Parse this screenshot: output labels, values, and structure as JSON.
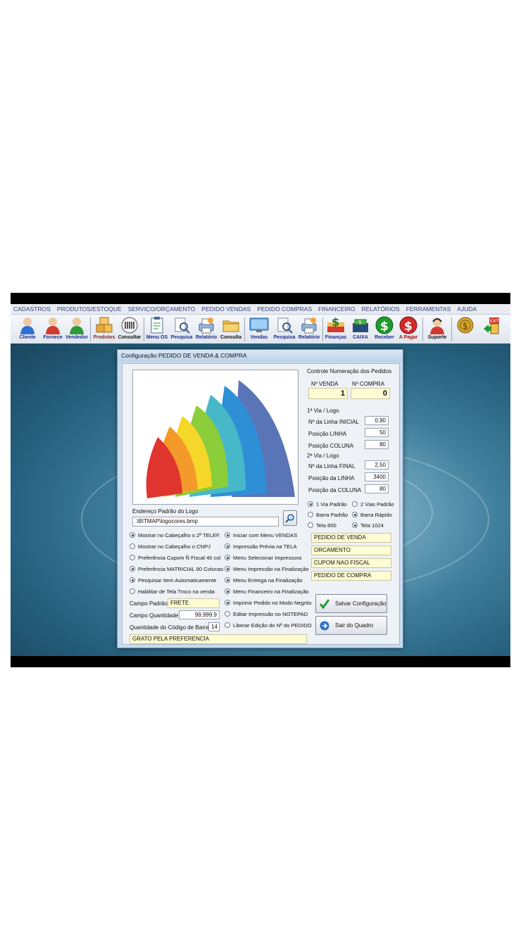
{
  "menu": [
    "CADASTROS",
    "PRODUTOS/ESTOQUE",
    "SERVIÇO/ORÇAMENTO",
    "PEDIDO VENDAS",
    "PEDIDO COMPRAS",
    "FINANCEIRO",
    "RELATÓRIOS",
    "FERRAMENTAS",
    "AJUDA"
  ],
  "toolbar": {
    "cliente": "Cliente",
    "fornece": "Fornece",
    "vendedor": "Vendedor",
    "produtos": "Produtos",
    "consultar": "Consultar",
    "menu_os": "Menu OS",
    "pesquisa": "Pesquisa",
    "relatorio": "Relatório",
    "consulta": "Consulta",
    "vendas": "Vendas",
    "pesquisa2": "Pesquisa",
    "relatorio2": "Relatório",
    "financas": "Finanças",
    "caixa": "CAIXA",
    "receber": "Receber",
    "a_pagar": "A Pagar",
    "suporte": "Suporte"
  },
  "dialog": {
    "title": "Configuração PEDIDO DE VENDA & COMPRA",
    "logo_address_label": "Endereço Padrão do Logo",
    "logo_path": ".\\BITMAP\\logocores.bmp",
    "controle": {
      "title": "Controle Numeração dos Pedidos",
      "venda_label": "Nº VENDA",
      "compra_label": "Nº COMPRA",
      "venda_value": "1",
      "compra_value": "0"
    },
    "via1": {
      "title": "1ª Via / Logo",
      "linha_inicial_label": "Nº da Linha INICIAL",
      "linha_inicial": "0,90",
      "posicao_linha_label": "Posição LINHA",
      "posicao_linha": "50",
      "posicao_coluna_label": "Posição COLUNA",
      "posicao_coluna": "80"
    },
    "via2": {
      "title": "2ª Via / Logo",
      "linha_final_label": "Nº da Linha FINAL",
      "linha_final": "2,50",
      "posicao_linha_label": "Posição da LINHA",
      "posicao_linha": "3400",
      "posicao_coluna_label": "Posição da COLUNA",
      "posicao_coluna": "80"
    },
    "radio_groups": {
      "via_padrao": "1 Via Padrão",
      "vias_padrao": "2 Vias Padrão",
      "barra_padrao": "Barra Padrão",
      "barra_rapido": "Barra Rápido",
      "tela_800": "Tela 800",
      "tela_1024": "Tela 1024"
    },
    "titles": [
      "PEDIDO DE VENDA",
      "ORCAMENTO",
      "CUPOM NAO FISCAL",
      "PEDIDO DE COMPRA"
    ],
    "options_left": [
      {
        "label": "Mostrar no Cabeçalho o 2º TELEF.",
        "checked": true
      },
      {
        "label": "Mostrar no Cabeçalho o CNPJ",
        "checked": false
      },
      {
        "label": "Preferência Cupom Ñ Fiscal 40 col",
        "checked": false
      },
      {
        "label": "Preferência MATRICIAL 80 Colunas",
        "checked": true
      },
      {
        "label": "Pesquisar Item Automaticamente",
        "checked": true
      },
      {
        "label": "Habilitar de Tela Troco na venda",
        "checked": false
      }
    ],
    "options_right": [
      {
        "label": "Iniciar com Menu VENDAS",
        "checked": true
      },
      {
        "label": "Impressão Prévia na TELA",
        "checked": true
      },
      {
        "label": "Menu Selecionar Impressora",
        "checked": true
      },
      {
        "label": "Menu Impressão na Finalização",
        "checked": true
      },
      {
        "label": "Menu Entrega na Finalização",
        "checked": true
      },
      {
        "label": "Menu Financeiro na Finalização",
        "checked": true
      },
      {
        "label": "Imprimir Pedido no Modo Negrito",
        "checked": true
      },
      {
        "label": "Editar Impressão no NOTEPAD",
        "checked": false
      },
      {
        "label": "Liberar Edição do Nº do PEDIDO",
        "checked": false
      }
    ],
    "campo_padrao_label": "Campo Padrão",
    "campo_padrao": "FRETE",
    "campo_quantidade_label": "Campo Quantidade",
    "campo_quantidade": "99,999.9",
    "codigo_barras_label": "Quantidade do Código de Barras",
    "codigo_barras": "14",
    "footer_text": "GRATO PELA PREFERENCIA",
    "save_button": "Salvar Configuração",
    "exit_button": "Sair do Quadro"
  },
  "colors": {
    "accent_green": "#1f9a2e",
    "accent_blue": "#2a6fc9",
    "field_yellow": "#fffbd2"
  }
}
